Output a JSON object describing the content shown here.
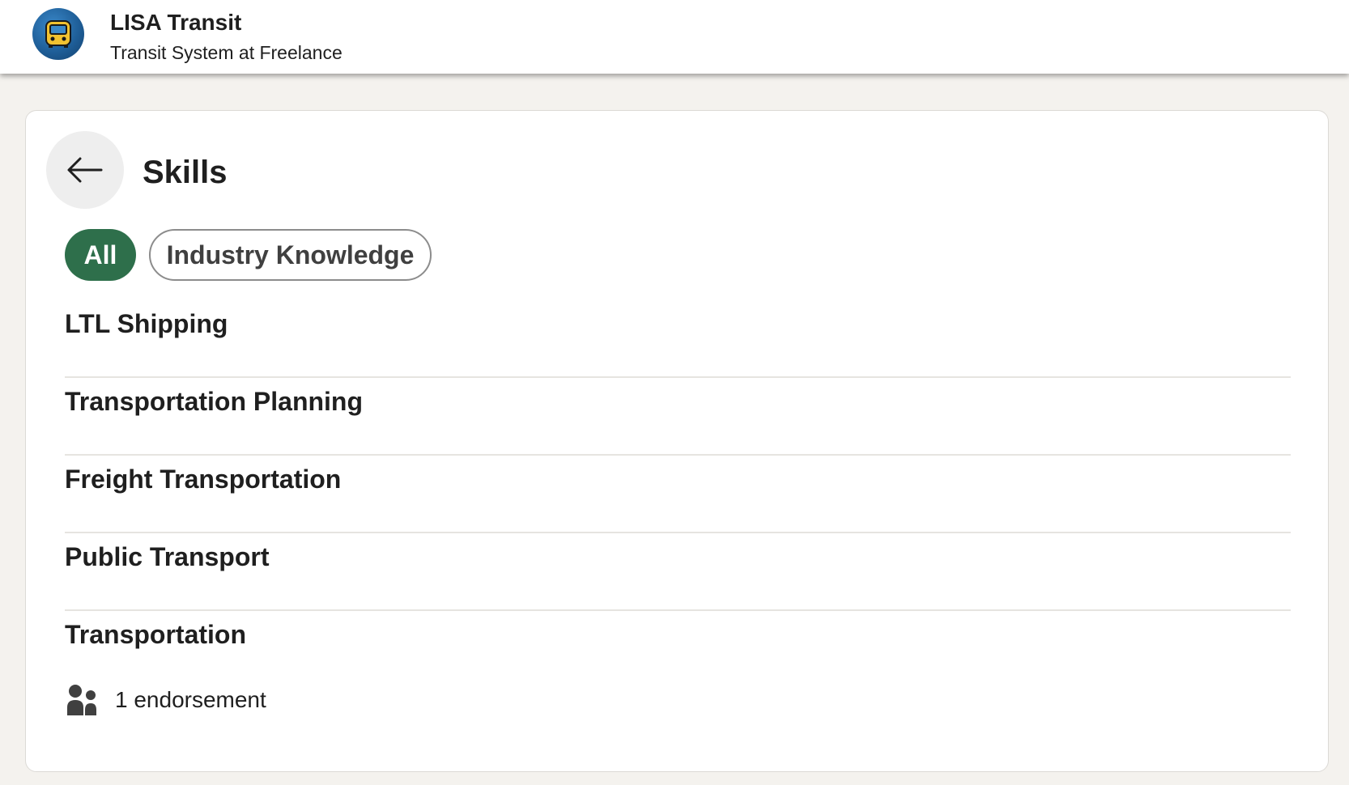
{
  "header": {
    "company_name": "LISA Transit",
    "subtitle": "Transit System at Freelance",
    "logo_icon": "bus-logo-icon"
  },
  "page": {
    "title": "Skills",
    "back_icon": "arrow-left-icon"
  },
  "filters": [
    {
      "label": "All",
      "selected": true
    },
    {
      "label": "Industry Knowledge",
      "selected": false
    }
  ],
  "skills": [
    {
      "name": "LTL Shipping"
    },
    {
      "name": "Transportation Planning"
    },
    {
      "name": "Freight Transportation"
    },
    {
      "name": "Public Transport"
    },
    {
      "name": "Transportation",
      "endorsements": "1 endorsement",
      "endorsement_icon": "people-icon"
    }
  ],
  "colors": {
    "accent_green": "#2e6f4b",
    "background": "#f4f2ee",
    "logo_blue": "#1f5f99",
    "logo_yellow": "#f2c230"
  }
}
